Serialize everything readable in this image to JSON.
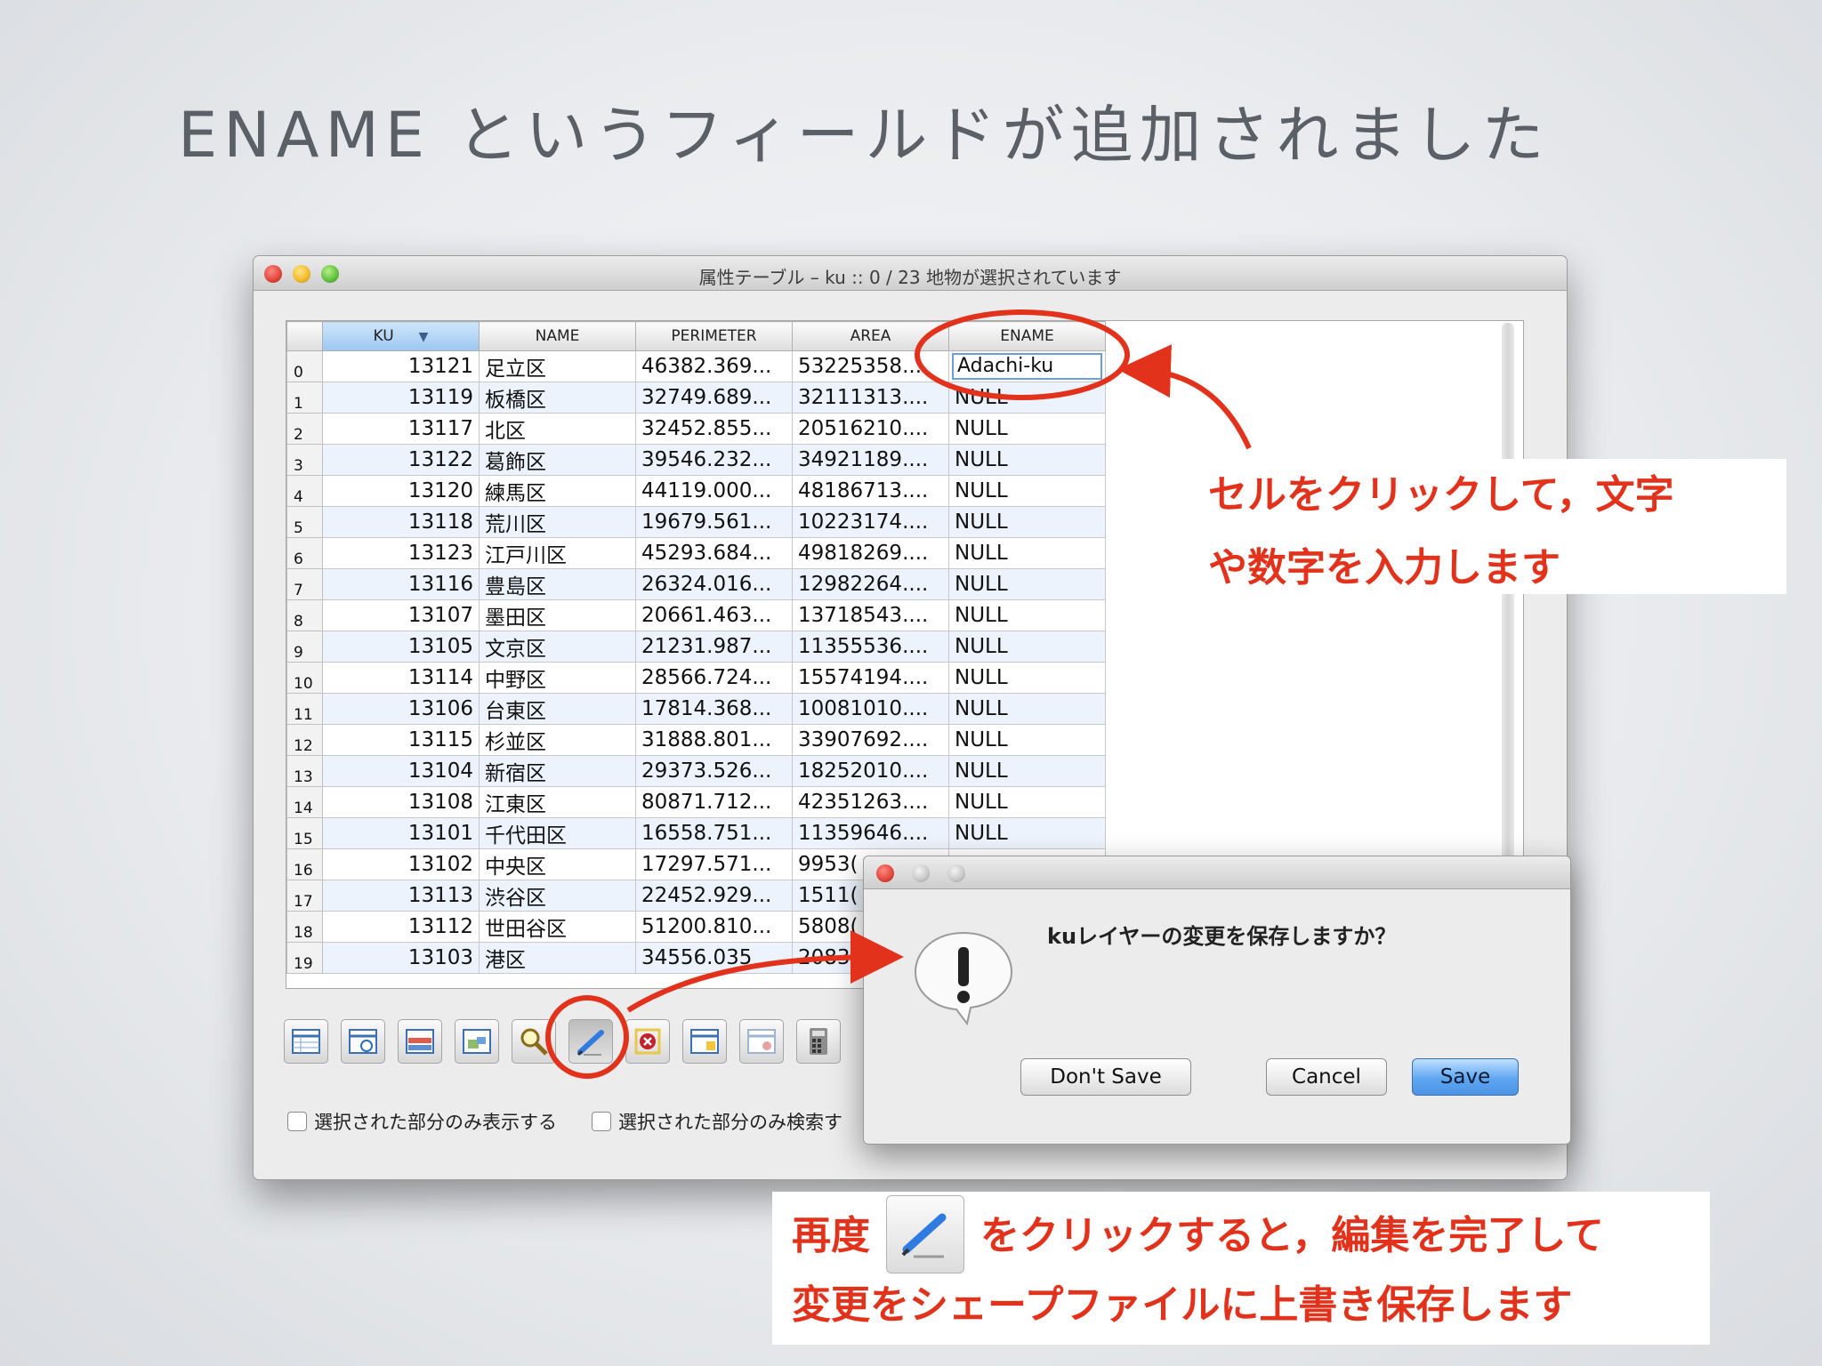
{
  "slide": {
    "title": "ENAME というフィールドが追加されました"
  },
  "window": {
    "title": "属性テーブル – ku :: 0 / 23 地物が選択されています"
  },
  "table": {
    "columns": [
      "KU",
      "NAME",
      "PERIMETER",
      "AREA",
      "ENAME"
    ],
    "sort_indicator": "▼",
    "rows": [
      [
        "0",
        "13121",
        "足立区",
        "46382.369...",
        "53225358...",
        "Adachi-ku"
      ],
      [
        "1",
        "13119",
        "板橋区",
        "32749.689...",
        "32111313....",
        "NULL"
      ],
      [
        "2",
        "13117",
        "北区",
        "32452.855...",
        "20516210....",
        "NULL"
      ],
      [
        "3",
        "13122",
        "葛飾区",
        "39546.232...",
        "34921189....",
        "NULL"
      ],
      [
        "4",
        "13120",
        "練馬区",
        "44119.000...",
        "48186713....",
        "NULL"
      ],
      [
        "5",
        "13118",
        "荒川区",
        "19679.561...",
        "10223174....",
        "NULL"
      ],
      [
        "6",
        "13123",
        "江戸川区",
        "45293.684...",
        "49818269....",
        "NULL"
      ],
      [
        "7",
        "13116",
        "豊島区",
        "26324.016...",
        "12982264....",
        "NULL"
      ],
      [
        "8",
        "13107",
        "墨田区",
        "20661.463...",
        "13718543....",
        "NULL"
      ],
      [
        "9",
        "13105",
        "文京区",
        "21231.987...",
        "11355536....",
        "NULL"
      ],
      [
        "10",
        "13114",
        "中野区",
        "28566.724...",
        "15574194....",
        "NULL"
      ],
      [
        "11",
        "13106",
        "台東区",
        "17814.368...",
        "10081010....",
        "NULL"
      ],
      [
        "12",
        "13115",
        "杉並区",
        "31888.801...",
        "33907692....",
        "NULL"
      ],
      [
        "13",
        "13104",
        "新宿区",
        "29373.526...",
        "18252010....",
        "NULL"
      ],
      [
        "14",
        "13108",
        "江東区",
        "80871.712...",
        "42351263....",
        "NULL"
      ],
      [
        "15",
        "13101",
        "千代田区",
        "16558.751...",
        "11359646....",
        "NULL"
      ],
      [
        "16",
        "13102",
        "中央区",
        "17297.571...",
        "9953(",
        ""
      ],
      [
        "17",
        "13113",
        "渋谷区",
        "22452.929...",
        "1511(",
        ""
      ],
      [
        "18",
        "13112",
        "世田谷区",
        "51200.810...",
        "5808(",
        ""
      ],
      [
        "19",
        "13103",
        "港区",
        "34556.035",
        "2083(",
        ""
      ]
    ]
  },
  "toolbar": {
    "buttons": [
      {
        "name": "open-table-icon"
      },
      {
        "name": "invert-selection-icon"
      },
      {
        "name": "select-all-icon"
      },
      {
        "name": "zoom-to-selection-icon"
      },
      {
        "name": "search-icon"
      },
      {
        "name": "edit-pencil-icon",
        "pressed": true
      },
      {
        "name": "delete-feature-icon"
      },
      {
        "name": "new-column-icon"
      },
      {
        "name": "delete-column-icon"
      },
      {
        "name": "calculator-icon"
      }
    ]
  },
  "filters": {
    "show_selected_label": "選択された部分のみ表示する",
    "search_selected_label": "選択された部分のみ検索す"
  },
  "dialog": {
    "message": "kuレイヤーの変更を保存しますか？",
    "dont_save": "Don't Save",
    "cancel": "Cancel",
    "save": "Save"
  },
  "annotations": {
    "callout1_line1": "セルをクリックして，文字",
    "callout1_line2": "や数字を入力します",
    "callout2_prefix": "再度",
    "callout2_suffix": "をクリックすると，編集を完了して",
    "callout2_line2": "変更をシェープファイルに上書き保存します"
  },
  "colors": {
    "annotation_red": "#e3321b",
    "primary_button_blue": "#5ea6f0"
  }
}
